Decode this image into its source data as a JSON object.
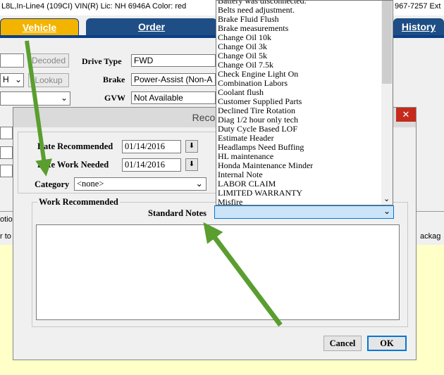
{
  "topbar": {
    "left_text": "L8L,In-Line4 (109CI) VIN(R) Lic: NH 6946A  Color: red",
    "right_text": "967-7257 Ext"
  },
  "tabs": [
    {
      "label": "Vehicle"
    },
    {
      "label": "Order"
    },
    {
      "label": "History"
    }
  ],
  "vehicle_form": {
    "decoded_button": "Decoded",
    "lookup_button": "Lookup",
    "left_select_value": "H",
    "drive_type_label": "Drive Type",
    "drive_type_value": "FWD",
    "brake_label": "Brake",
    "brake_value": "Power-Assist (Non-A",
    "gvw_label": "GVW",
    "gvw_value": "Not Available",
    "left_cut_label": "otio",
    "left_cut_text": "r to",
    "right_cut_text": "ackag"
  },
  "dialog": {
    "title": "Recomme",
    "close_glyph": "✕",
    "date_recommended_label": "Date Recommended",
    "date_recommended_value": "01/14/2016",
    "date_work_needed_label": "Date Work Needed",
    "date_work_needed_value": "01/14/2016",
    "category_label": "Category",
    "category_value": "<none>",
    "work_recommended_label": "Work Recommended",
    "standard_notes_label": "Standard Notes",
    "cancel_button": "Cancel",
    "ok_button": "OK"
  },
  "standard_notes_dropdown": {
    "items": [
      "Battery was disconnected.",
      "Belts need adjustment.",
      "Brake Fluid Flush",
      "Brake measurements",
      "Change Oil 10k",
      "Change Oil 3k",
      "Change Oil 5k",
      "Change Oil 7.5k",
      "Check Engine Light On",
      "Combination Labors",
      "Coolant flush",
      "Customer Supplied Parts",
      "Declined Tire Rotation",
      "Diag 1/2 hour only tech",
      "Duty Cycle Based LOF",
      "Estimate Header",
      "Headlamps Need Buffing",
      "HL maintenance",
      "Honda Maintenance Minder",
      "Internal Note",
      "LABOR CLAIM",
      "LIMITED WARRANTY",
      "Misfire"
    ]
  },
  "icons": {
    "chevron": "⌄",
    "calendar_down": "⬇"
  },
  "colors": {
    "tab_blue": "#1e4e85",
    "tab_active": "#f3b400",
    "arrow_green": "#5a9e2f",
    "note_yellow": "#ffffc8",
    "focus_blue": "#0078d7"
  }
}
